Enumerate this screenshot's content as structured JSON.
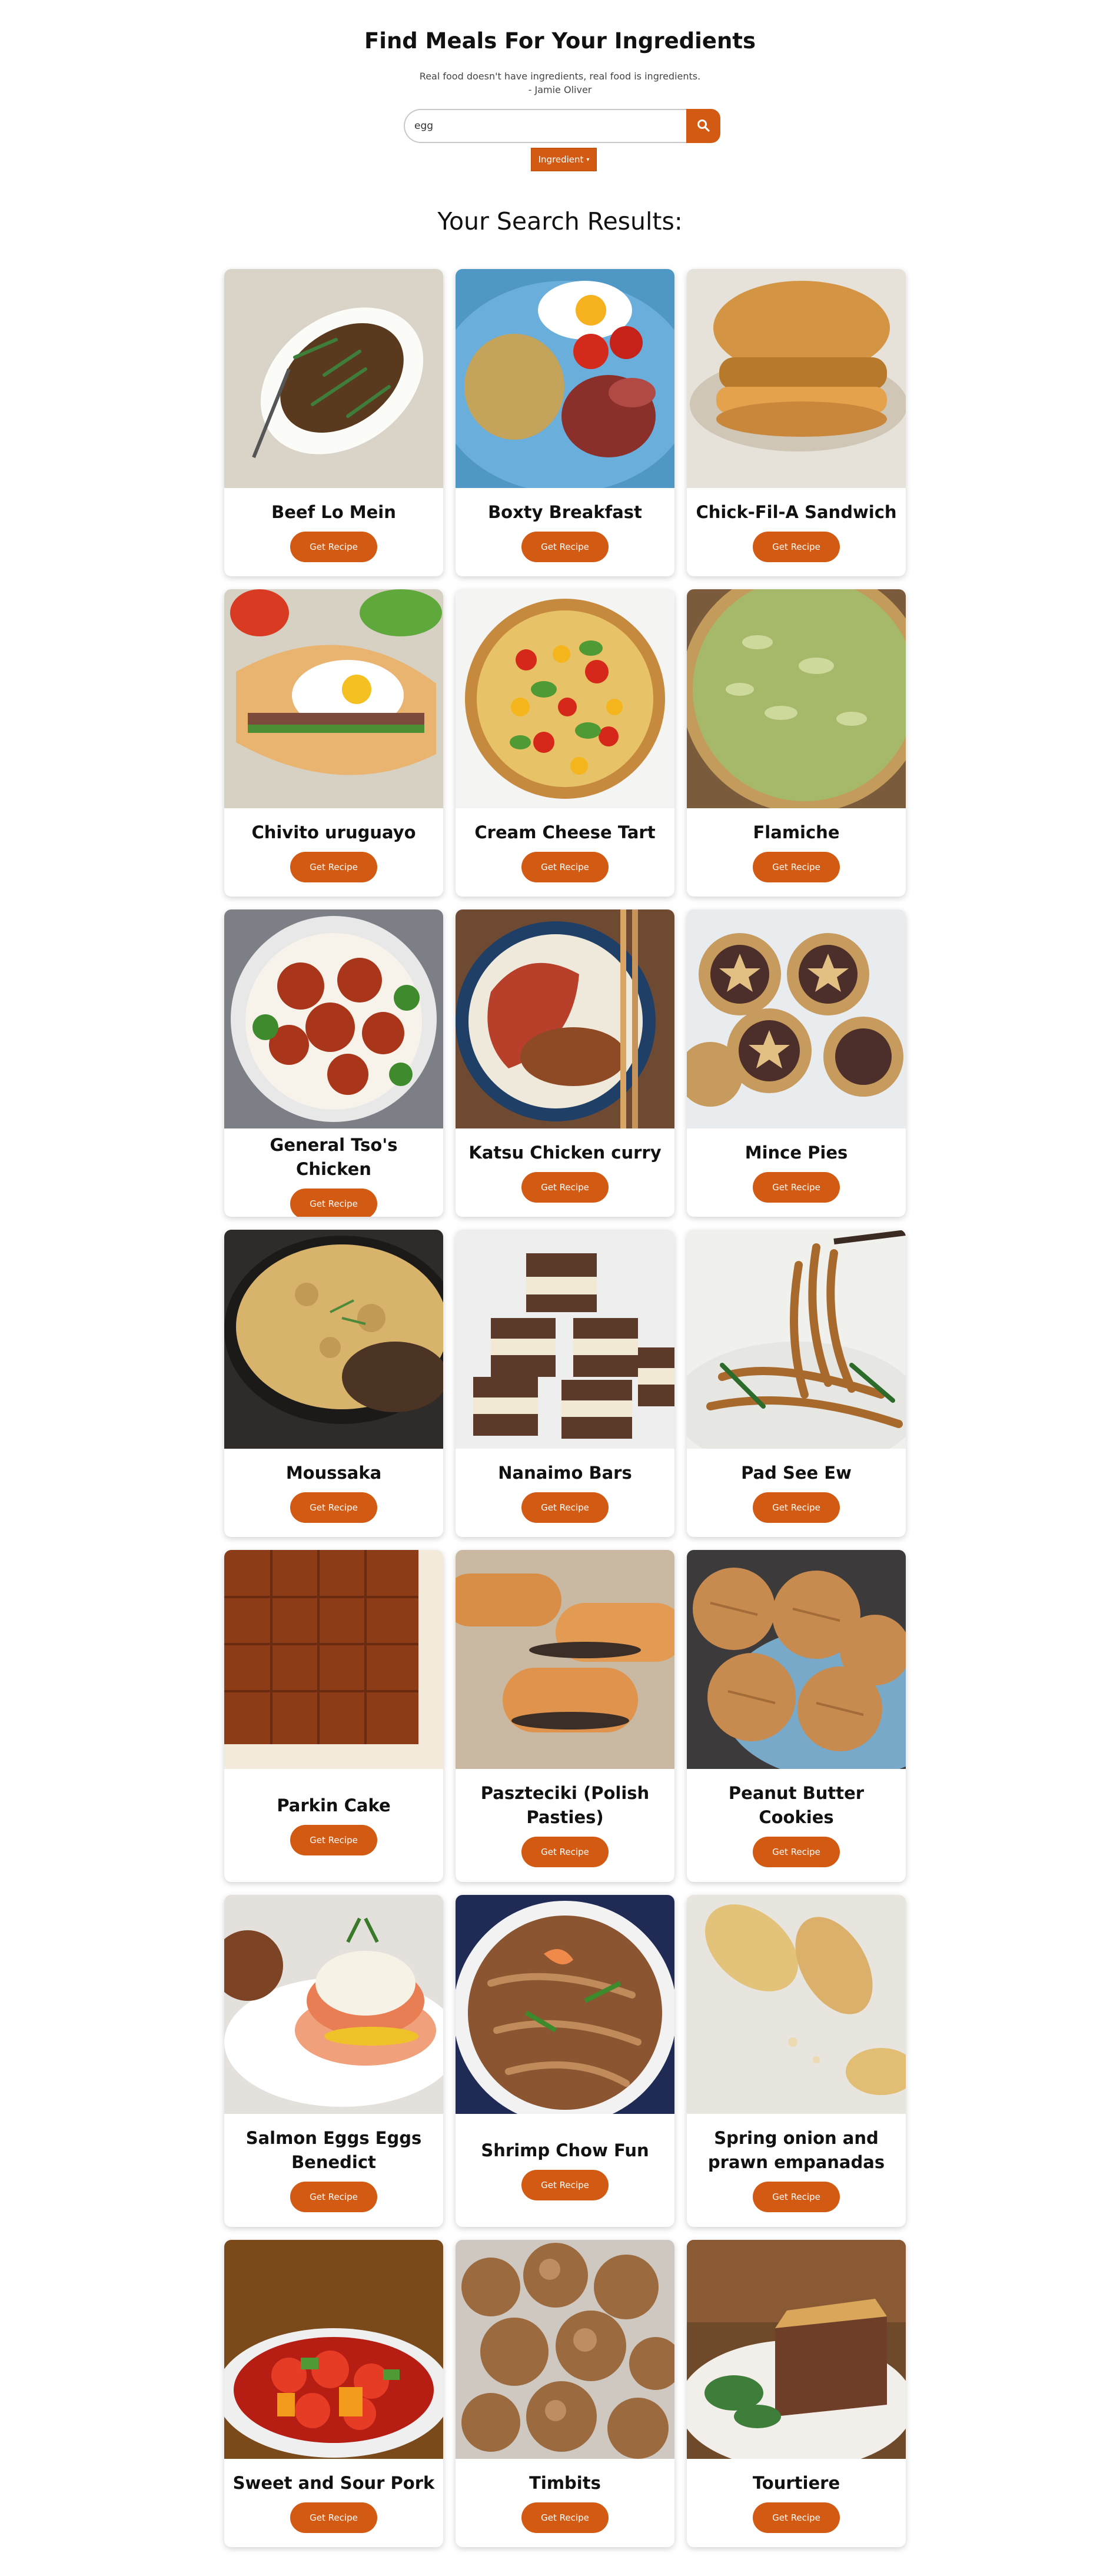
{
  "header": {
    "title": "Find Meals For Your Ingredients",
    "quote_text": "Real food doesn't have ingredients, real food is ingredients.",
    "quote_author": "- Jamie Oliver"
  },
  "search": {
    "value": "egg",
    "placeholder": "",
    "button_icon": "search-icon"
  },
  "filter": {
    "selected": "Ingredient",
    "icon": "chevron-down-icon"
  },
  "results_heading": "Your Search Results:",
  "button_label": "Get Recipe",
  "colors": {
    "accent": "#d35a13",
    "text": "#111111"
  },
  "recipes": [
    {
      "title": "Beef Lo Mein",
      "image": "beef-lo-mein-photo"
    },
    {
      "title": "Boxty Breakfast",
      "image": "boxty-breakfast-photo"
    },
    {
      "title": "Chick-Fil-A Sandwich",
      "image": "chick-fil-a-sandwich-photo"
    },
    {
      "title": "Chivito uruguayo",
      "image": "chivito-uruguayo-photo"
    },
    {
      "title": "Cream Cheese Tart",
      "image": "cream-cheese-tart-photo"
    },
    {
      "title": "Flamiche",
      "image": "flamiche-photo"
    },
    {
      "title": "General Tso's Chicken",
      "image": "general-tsos-chicken-photo"
    },
    {
      "title": "Katsu Chicken curry",
      "image": "katsu-chicken-curry-photo"
    },
    {
      "title": "Mince Pies",
      "image": "mince-pies-photo"
    },
    {
      "title": "Moussaka",
      "image": "moussaka-photo"
    },
    {
      "title": "Nanaimo Bars",
      "image": "nanaimo-bars-photo"
    },
    {
      "title": "Pad See Ew",
      "image": "pad-see-ew-photo"
    },
    {
      "title": "Parkin Cake",
      "image": "parkin-cake-photo"
    },
    {
      "title": "Paszteciki (Polish Pasties)",
      "image": "paszteciki-photo"
    },
    {
      "title": "Peanut Butter Cookies",
      "image": "peanut-butter-cookies-photo"
    },
    {
      "title": "Salmon Eggs Eggs Benedict",
      "image": "salmon-eggs-benedict-photo"
    },
    {
      "title": "Shrimp Chow Fun",
      "image": "shrimp-chow-fun-photo"
    },
    {
      "title": "Spring onion and prawn empanadas",
      "image": "spring-onion-prawn-empanadas-photo"
    },
    {
      "title": "Sweet and Sour Pork",
      "image": "sweet-and-sour-pork-photo"
    },
    {
      "title": "Timbits",
      "image": "timbits-photo"
    },
    {
      "title": "Tourtiere",
      "image": "tourtiere-photo"
    }
  ]
}
